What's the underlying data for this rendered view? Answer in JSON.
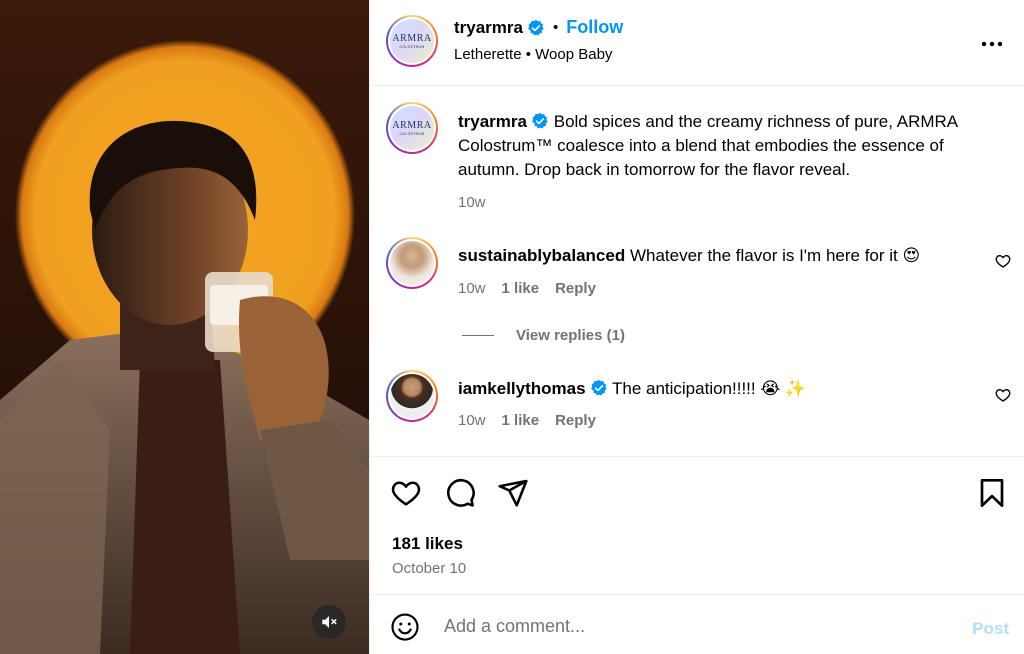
{
  "post": {
    "author": "tryarmra",
    "follow_label": "Follow",
    "separator": "•",
    "audio": "Letherette • Woop Baby",
    "avatar_logo_text": "ARMRA",
    "avatar_logo_sub": "COLOSTRUM",
    "caption": "Bold spices and the creamy richness of pure, ARMRA Colostrum™ coalesce into a blend that embodies the essence of autumn. Drop back in tomorrow for the flavor reveal.",
    "caption_age": "10w",
    "likes": "181 likes",
    "date": "October 10"
  },
  "comments": [
    {
      "user": "sustainablybalanced",
      "text": "Whatever the flavor is I'm here for it 😍",
      "age": "10w",
      "likes": "1 like",
      "reply_label": "Reply",
      "view_replies": "View replies (1)"
    },
    {
      "user": "iamkellythomas",
      "text": "The anticipation!!!!! 😭 ✨",
      "age": "10w",
      "likes": "1 like",
      "reply_label": "Reply"
    }
  ],
  "composer": {
    "placeholder": "Add a comment...",
    "post_label": "Post"
  },
  "colors": {
    "accent": "#0095f6",
    "muted": "#737373",
    "post_disabled": "#b2dffc",
    "media_orange": "#f5a521"
  },
  "icons": [
    "verified-badge-icon",
    "more-options-icon",
    "heart-icon",
    "comment-icon",
    "share-icon",
    "save-icon",
    "emoji-icon",
    "mute-icon"
  ]
}
